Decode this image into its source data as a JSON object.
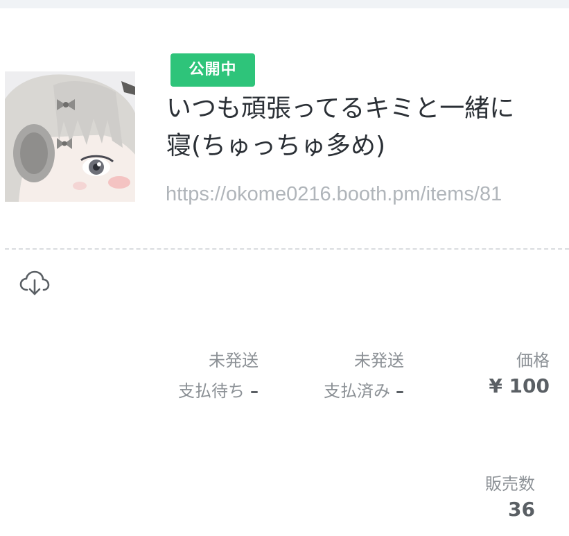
{
  "item": {
    "status_badge": "公開中",
    "title_line1": "いつも頑張ってるキミと一緒に",
    "title_line2": "寝(ちゅっちゅ多め)",
    "url": "https://okome0216.booth.pm/items/81"
  },
  "stats": {
    "unshipped_pending": {
      "label_top": "未発送",
      "label": "支払待ち",
      "value": "–"
    },
    "unshipped_paid": {
      "label_top": "未発送",
      "label": "支払済み",
      "value": "–"
    },
    "price": {
      "label": "価格",
      "value": "¥ 100"
    },
    "sales": {
      "label": "販売数",
      "value": "36"
    }
  },
  "icons": {
    "download": "cloud-download-icon"
  },
  "colors": {
    "badge": "#2ec47a",
    "url": "#b0b5ba",
    "title": "#2b3036"
  }
}
